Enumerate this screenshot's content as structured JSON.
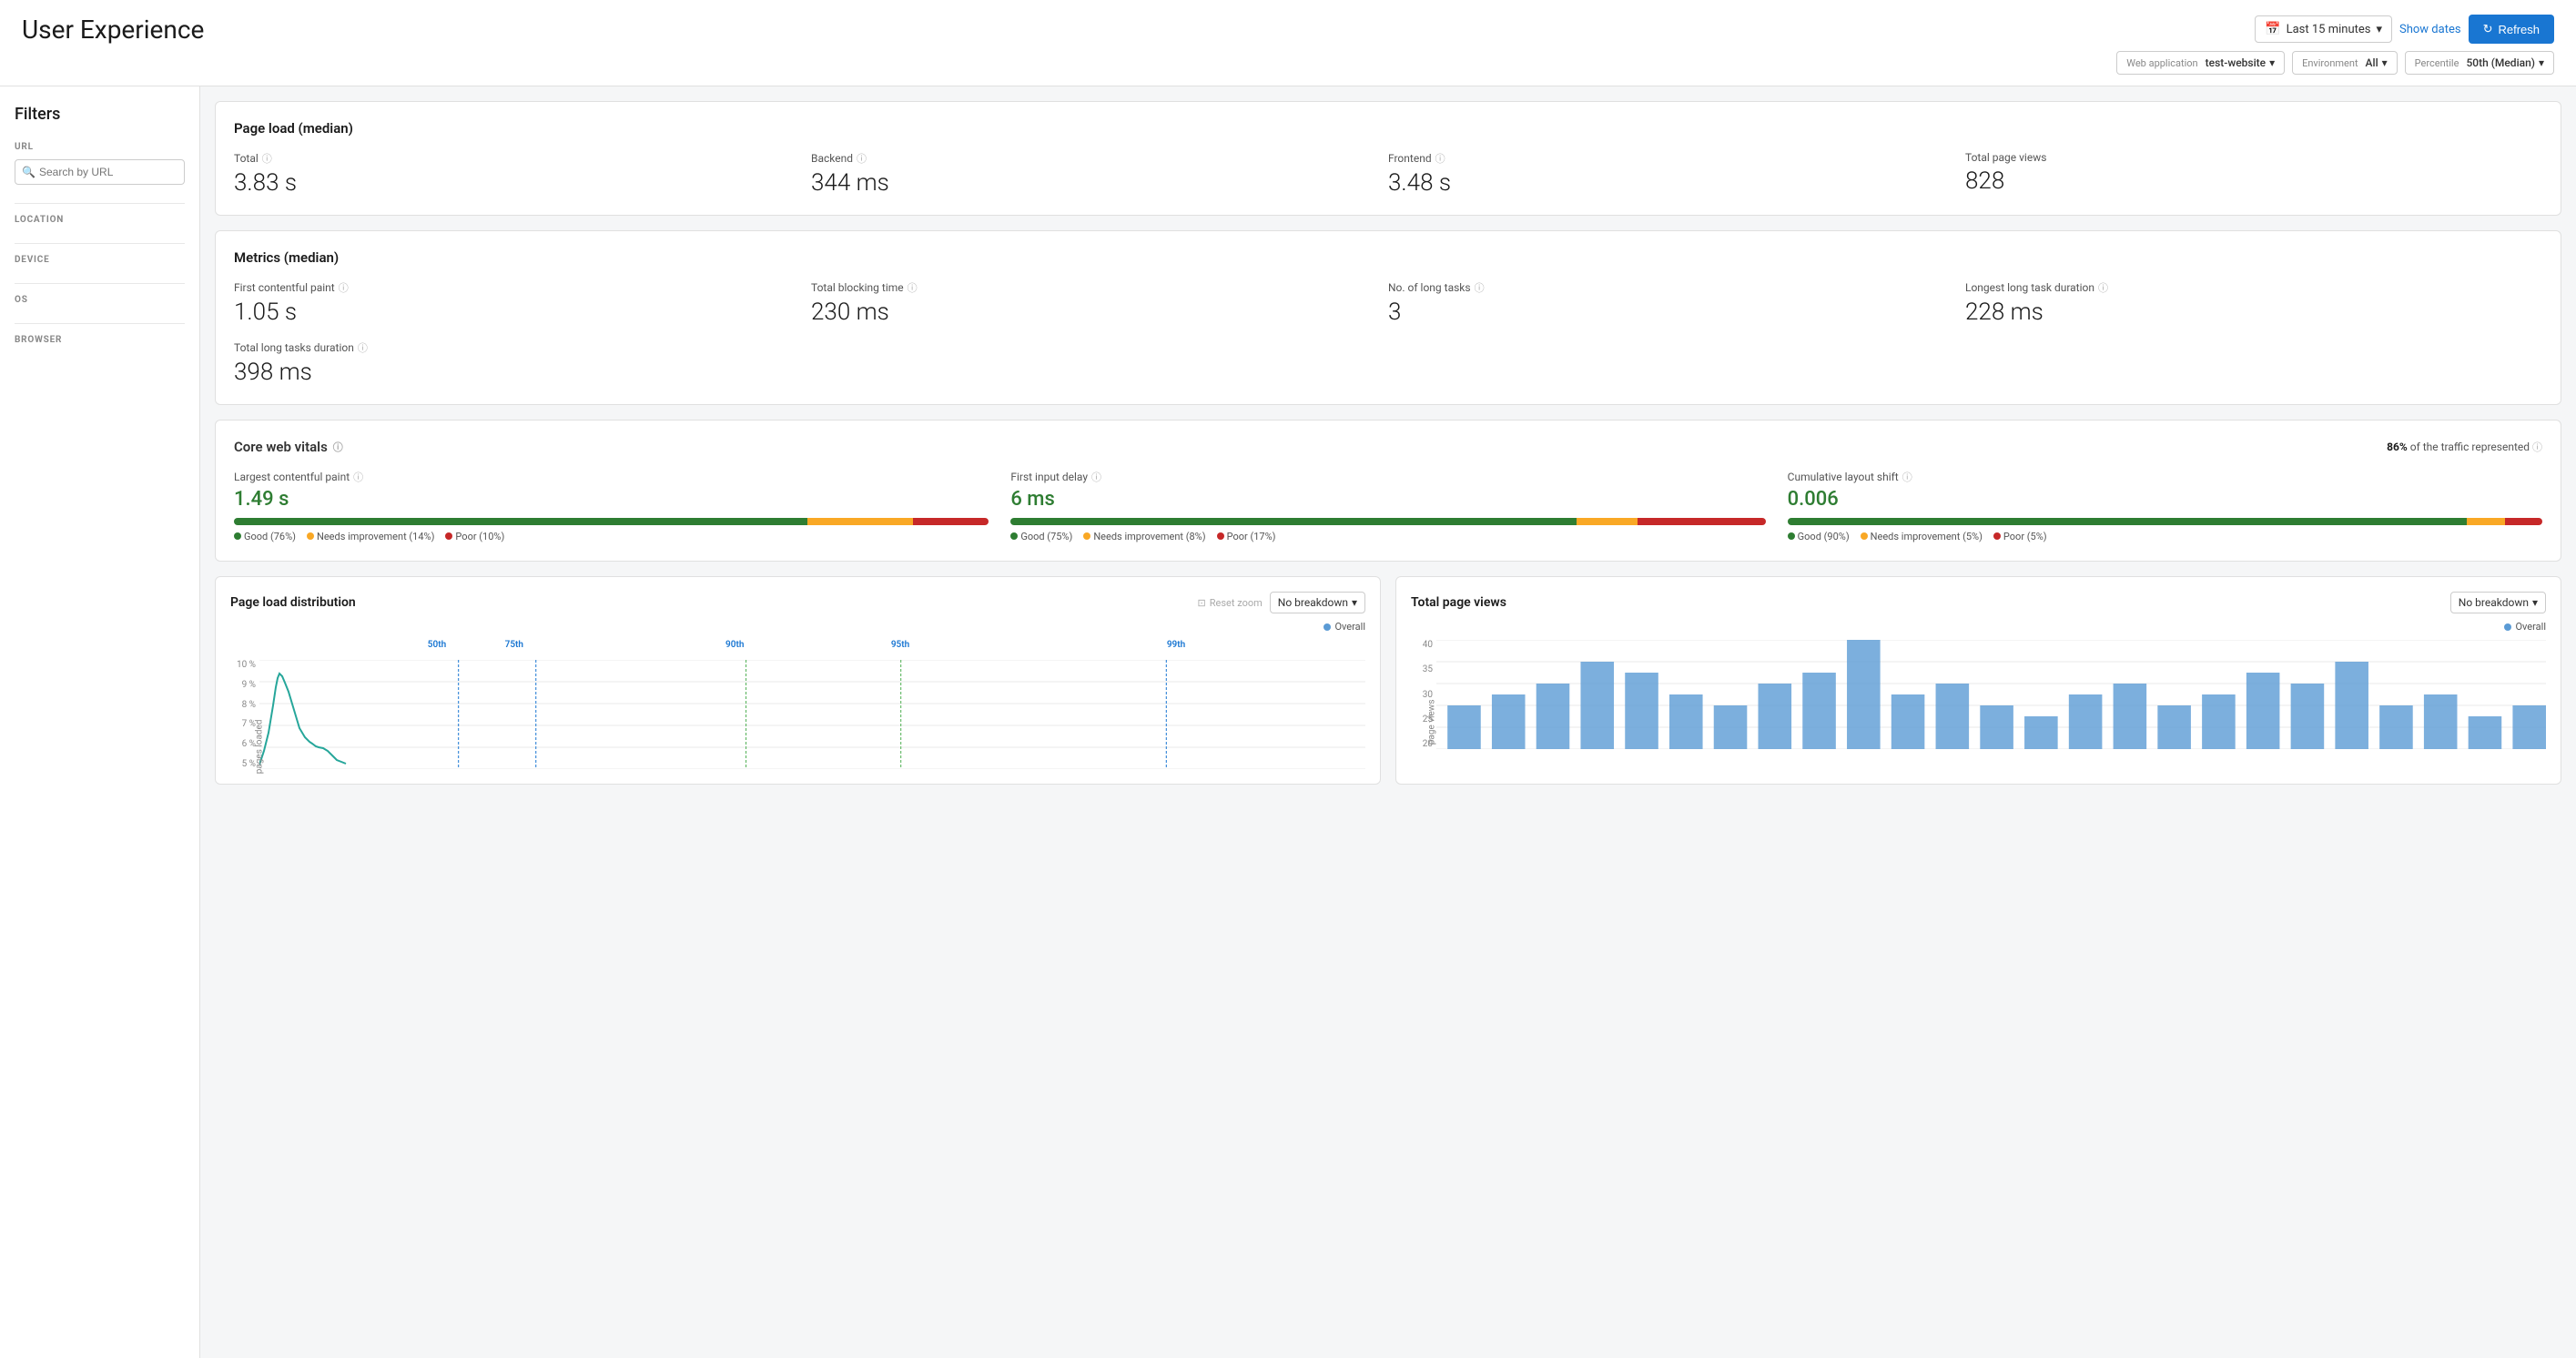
{
  "header": {
    "title": "User Experience",
    "time": {
      "label": "Last 15 minutes",
      "show_dates": "Show dates",
      "refresh": "Refresh"
    },
    "filters": {
      "web_application_label": "Web application",
      "web_application_value": "test-website",
      "environment_label": "Environment",
      "environment_value": "All",
      "percentile_label": "Percentile",
      "percentile_value": "50th (Median)"
    }
  },
  "sidebar": {
    "title": "Filters",
    "url_label": "URL",
    "url_placeholder": "Search by URL",
    "location_label": "LOCATION",
    "device_label": "DEVICE",
    "os_label": "OS",
    "browser_label": "BROWSER"
  },
  "page_load": {
    "title": "Page load (median)",
    "metrics": [
      {
        "name": "Total",
        "value": "3.83 s",
        "has_info": true
      },
      {
        "name": "Backend",
        "value": "344 ms",
        "has_info": true
      },
      {
        "name": "Frontend",
        "value": "3.48 s",
        "has_info": true
      },
      {
        "name": "Total page views",
        "value": "828",
        "has_info": false
      }
    ]
  },
  "metrics_median": {
    "title": "Metrics (median)",
    "metrics": [
      {
        "name": "First contentful paint",
        "value": "1.05 s",
        "has_info": true
      },
      {
        "name": "Total blocking time",
        "value": "230 ms",
        "has_info": true
      },
      {
        "name": "No. of long tasks",
        "value": "3",
        "has_info": true
      },
      {
        "name": "Longest long task duration",
        "value": "228 ms",
        "has_info": true
      }
    ],
    "second_row": [
      {
        "name": "Total long tasks duration",
        "value": "398 ms",
        "has_info": true
      }
    ]
  },
  "core_web_vitals": {
    "title": "Core web vitals",
    "traffic_label": "of the traffic represented",
    "traffic_percent": "86%",
    "vitals": [
      {
        "name": "Largest contentful paint",
        "value": "1.49 s",
        "good_pct": 76,
        "needs_pct": 14,
        "poor_pct": 10,
        "legend": [
          {
            "label": "Good (76%)",
            "color": "#2e7d32"
          },
          {
            "label": "Needs improvement (14%)",
            "color": "#f9a825"
          },
          {
            "label": "Poor (10%)",
            "color": "#c62828"
          }
        ]
      },
      {
        "name": "First input delay",
        "value": "6 ms",
        "good_pct": 75,
        "needs_pct": 8,
        "poor_pct": 17,
        "legend": [
          {
            "label": "Good (75%)",
            "color": "#2e7d32"
          },
          {
            "label": "Needs improvement (8%)",
            "color": "#f9a825"
          },
          {
            "label": "Poor (17%)",
            "color": "#c62828"
          }
        ]
      },
      {
        "name": "Cumulative layout shift",
        "value": "0.006",
        "good_pct": 90,
        "needs_pct": 5,
        "poor_pct": 5,
        "legend": [
          {
            "label": "Good (90%)",
            "color": "#2e7d32"
          },
          {
            "label": "Needs improvement (5%)",
            "color": "#f9a825"
          },
          {
            "label": "Poor (5%)",
            "color": "#c62828"
          }
        ]
      }
    ]
  },
  "charts": {
    "page_load_dist": {
      "title": "Page load distribution",
      "reset_zoom": "Reset zoom",
      "breakdown": "No breakdown",
      "overall_label": "Overall",
      "percentiles": [
        "50th",
        "75th",
        "90th",
        "95th",
        "99th"
      ],
      "y_labels": [
        "10 %",
        "9 %",
        "8 %",
        "7 %",
        "6 %",
        "5 %"
      ],
      "y_axis_label": "pages loaded"
    },
    "total_page_views": {
      "title": "Total page views",
      "breakdown": "No breakdown",
      "overall_label": "Overall",
      "y_labels": [
        "40",
        "35",
        "30",
        "25",
        "20"
      ],
      "y_axis_label": "page views"
    }
  }
}
